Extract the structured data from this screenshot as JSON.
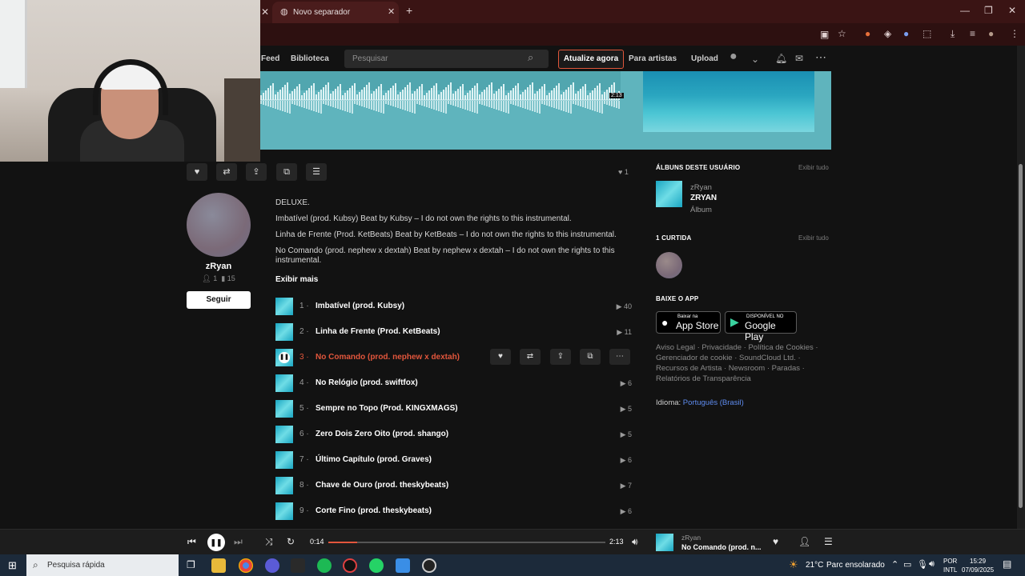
{
  "browser": {
    "tab_title": "Novo separador",
    "new_tab_symbol": "+"
  },
  "nav": {
    "feed": "Feed",
    "library": "Biblioteca",
    "search_placeholder": "Pesquisar",
    "upgrade": "Atualize agora",
    "for_artists": "Para artistas",
    "upload": "Upload"
  },
  "waveform": {
    "duration": "2:13"
  },
  "actions": {
    "like_count": "1"
  },
  "artist": {
    "name": "zRyan",
    "followers": "1",
    "tracks": "15",
    "follow": "Seguir"
  },
  "description": {
    "line1": "DELUXE.",
    "line2": "Imbatível (prod. Kubsy) Beat by Kubsy – I do not own the rights to this instrumental.",
    "line3": "Linha de Frente (Prod. KetBeats) Beat by KetBeats – I do not own the rights to this instrumental.",
    "line4": "No Comando (prod. nephew x dextah) Beat by nephew x dextah – I do not own the rights to this instrumental.",
    "show_more": "Exibir mais"
  },
  "tracks": [
    {
      "num": "1",
      "title": "Imbatível (prod. Kubsy)",
      "plays": "40"
    },
    {
      "num": "2",
      "title": "Linha de Frente (Prod. KetBeats)",
      "plays": "11"
    },
    {
      "num": "3",
      "title": "No Comando (prod. nephew x dextah)",
      "plays": ""
    },
    {
      "num": "4",
      "title": "No Relógio (prod. swiftfox)",
      "plays": "6"
    },
    {
      "num": "5",
      "title": "Sempre no Topo (Prod. KINGXMAGS)",
      "plays": "5"
    },
    {
      "num": "6",
      "title": "Zero Dois Zero Oito (prod. shango)",
      "plays": "5"
    },
    {
      "num": "7",
      "title": "Último Capítulo (prod. Graves)",
      "plays": "6"
    },
    {
      "num": "8",
      "title": "Chave de Ouro (prod. theskybeats)",
      "plays": "7"
    },
    {
      "num": "9",
      "title": "Corte Fino (prod. theskybeats)",
      "plays": "6"
    }
  ],
  "sidebar": {
    "albums_heading": "ÁLBUNS DESTE USUÁRIO",
    "view_all": "Exibir tudo",
    "album_artist": "zRyan",
    "album_title": "ZRYAN",
    "album_type": "Álbum",
    "likes_heading": "1 CURTIDA",
    "app_heading": "BAIXE O APP",
    "appstore_small": "Baixar na",
    "appstore_big": "App Store",
    "play_small": "DISPONÍVEL NO",
    "play_big": "Google Play",
    "footer_links": "Aviso Legal · Privacidade · Política de Cookies · Gerenciador de cookie · SoundCloud Ltd. · Recursos de Artista · Newsroom · Paradas · Relatórios de Transparência",
    "language_label": "Idioma:",
    "language_value": "Português (Brasil)"
  },
  "player": {
    "current_time": "0:14",
    "total_time": "2:13",
    "progress_fraction": 0.105,
    "artist": "zRyan",
    "title": "No Comando (prod. n..."
  },
  "taskbar": {
    "search": "Pesquisa rápida",
    "weather_temp": "21°C",
    "weather_desc": "Parc ensolarado",
    "lang1": "POR",
    "lang2": "INTL",
    "time": "15:29",
    "date": "07/09/2025"
  }
}
